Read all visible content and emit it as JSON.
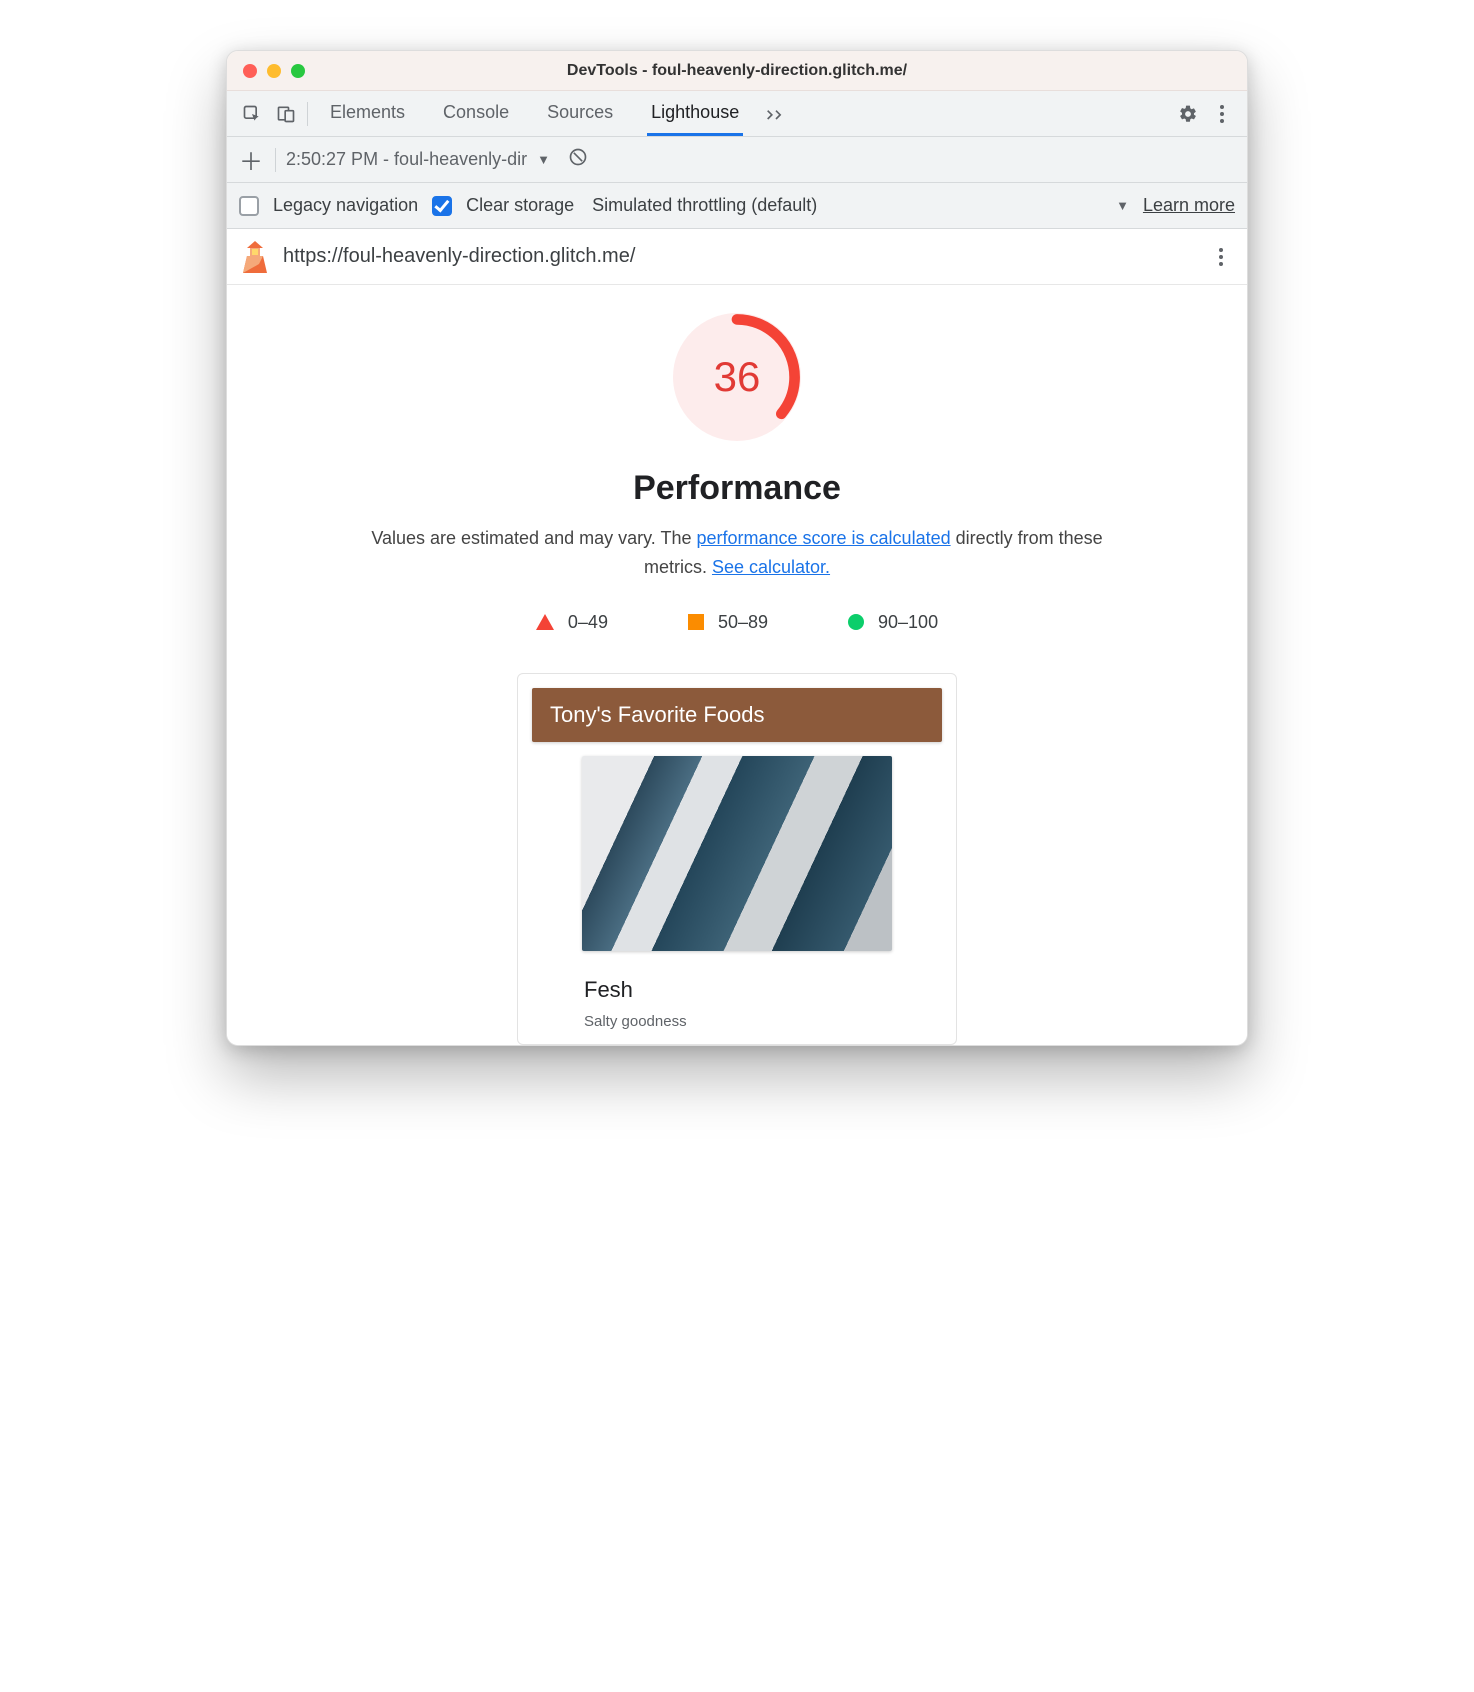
{
  "window": {
    "title": "DevTools - foul-heavenly-direction.glitch.me/"
  },
  "toolbar": {
    "tabs": [
      "Elements",
      "Console",
      "Sources",
      "Lighthouse"
    ],
    "active_tab": "Lighthouse"
  },
  "report_selector": {
    "label": "2:50:27 PM - foul-heavenly-dir"
  },
  "options": {
    "legacy_nav_label": "Legacy navigation",
    "legacy_nav_checked": false,
    "clear_storage_label": "Clear storage",
    "clear_storage_checked": true,
    "throttling_label": "Simulated throttling (default)",
    "learn_more": "Learn more"
  },
  "url_bar": {
    "url": "https://foul-heavenly-direction.glitch.me/"
  },
  "report": {
    "score": "36",
    "score_pct": 36,
    "score_color": "#f44336",
    "category": "Performance",
    "desc_prefix": "Values are estimated and may vary. The ",
    "desc_link1": "performance score is calculated",
    "desc_middle": " directly from these metrics. ",
    "desc_link2": "See calculator.",
    "legend": [
      {
        "range": "0–49"
      },
      {
        "range": "50–89"
      },
      {
        "range": "90–100"
      }
    ]
  },
  "preview": {
    "header": "Tony's Favorite Foods",
    "item_title": "Fesh",
    "item_subtitle": "Salty goodness"
  }
}
